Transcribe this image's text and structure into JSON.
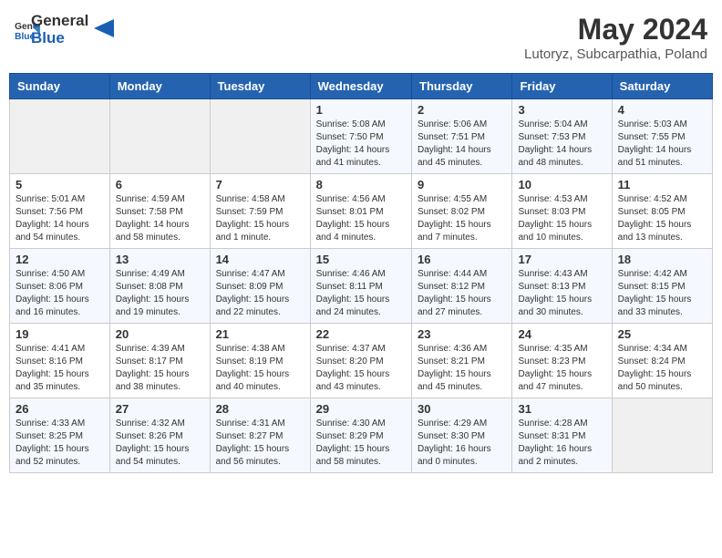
{
  "header": {
    "logo_general": "General",
    "logo_blue": "Blue",
    "month_title": "May 2024",
    "subtitle": "Lutoryz, Subcarpathia, Poland"
  },
  "weekdays": [
    "Sunday",
    "Monday",
    "Tuesday",
    "Wednesday",
    "Thursday",
    "Friday",
    "Saturday"
  ],
  "weeks": [
    [
      {
        "day": "",
        "info": ""
      },
      {
        "day": "",
        "info": ""
      },
      {
        "day": "",
        "info": ""
      },
      {
        "day": "1",
        "info": "Sunrise: 5:08 AM\nSunset: 7:50 PM\nDaylight: 14 hours\nand 41 minutes."
      },
      {
        "day": "2",
        "info": "Sunrise: 5:06 AM\nSunset: 7:51 PM\nDaylight: 14 hours\nand 45 minutes."
      },
      {
        "day": "3",
        "info": "Sunrise: 5:04 AM\nSunset: 7:53 PM\nDaylight: 14 hours\nand 48 minutes."
      },
      {
        "day": "4",
        "info": "Sunrise: 5:03 AM\nSunset: 7:55 PM\nDaylight: 14 hours\nand 51 minutes."
      }
    ],
    [
      {
        "day": "5",
        "info": "Sunrise: 5:01 AM\nSunset: 7:56 PM\nDaylight: 14 hours\nand 54 minutes."
      },
      {
        "day": "6",
        "info": "Sunrise: 4:59 AM\nSunset: 7:58 PM\nDaylight: 14 hours\nand 58 minutes."
      },
      {
        "day": "7",
        "info": "Sunrise: 4:58 AM\nSunset: 7:59 PM\nDaylight: 15 hours\nand 1 minute."
      },
      {
        "day": "8",
        "info": "Sunrise: 4:56 AM\nSunset: 8:01 PM\nDaylight: 15 hours\nand 4 minutes."
      },
      {
        "day": "9",
        "info": "Sunrise: 4:55 AM\nSunset: 8:02 PM\nDaylight: 15 hours\nand 7 minutes."
      },
      {
        "day": "10",
        "info": "Sunrise: 4:53 AM\nSunset: 8:03 PM\nDaylight: 15 hours\nand 10 minutes."
      },
      {
        "day": "11",
        "info": "Sunrise: 4:52 AM\nSunset: 8:05 PM\nDaylight: 15 hours\nand 13 minutes."
      }
    ],
    [
      {
        "day": "12",
        "info": "Sunrise: 4:50 AM\nSunset: 8:06 PM\nDaylight: 15 hours\nand 16 minutes."
      },
      {
        "day": "13",
        "info": "Sunrise: 4:49 AM\nSunset: 8:08 PM\nDaylight: 15 hours\nand 19 minutes."
      },
      {
        "day": "14",
        "info": "Sunrise: 4:47 AM\nSunset: 8:09 PM\nDaylight: 15 hours\nand 22 minutes."
      },
      {
        "day": "15",
        "info": "Sunrise: 4:46 AM\nSunset: 8:11 PM\nDaylight: 15 hours\nand 24 minutes."
      },
      {
        "day": "16",
        "info": "Sunrise: 4:44 AM\nSunset: 8:12 PM\nDaylight: 15 hours\nand 27 minutes."
      },
      {
        "day": "17",
        "info": "Sunrise: 4:43 AM\nSunset: 8:13 PM\nDaylight: 15 hours\nand 30 minutes."
      },
      {
        "day": "18",
        "info": "Sunrise: 4:42 AM\nSunset: 8:15 PM\nDaylight: 15 hours\nand 33 minutes."
      }
    ],
    [
      {
        "day": "19",
        "info": "Sunrise: 4:41 AM\nSunset: 8:16 PM\nDaylight: 15 hours\nand 35 minutes."
      },
      {
        "day": "20",
        "info": "Sunrise: 4:39 AM\nSunset: 8:17 PM\nDaylight: 15 hours\nand 38 minutes."
      },
      {
        "day": "21",
        "info": "Sunrise: 4:38 AM\nSunset: 8:19 PM\nDaylight: 15 hours\nand 40 minutes."
      },
      {
        "day": "22",
        "info": "Sunrise: 4:37 AM\nSunset: 8:20 PM\nDaylight: 15 hours\nand 43 minutes."
      },
      {
        "day": "23",
        "info": "Sunrise: 4:36 AM\nSunset: 8:21 PM\nDaylight: 15 hours\nand 45 minutes."
      },
      {
        "day": "24",
        "info": "Sunrise: 4:35 AM\nSunset: 8:23 PM\nDaylight: 15 hours\nand 47 minutes."
      },
      {
        "day": "25",
        "info": "Sunrise: 4:34 AM\nSunset: 8:24 PM\nDaylight: 15 hours\nand 50 minutes."
      }
    ],
    [
      {
        "day": "26",
        "info": "Sunrise: 4:33 AM\nSunset: 8:25 PM\nDaylight: 15 hours\nand 52 minutes."
      },
      {
        "day": "27",
        "info": "Sunrise: 4:32 AM\nSunset: 8:26 PM\nDaylight: 15 hours\nand 54 minutes."
      },
      {
        "day": "28",
        "info": "Sunrise: 4:31 AM\nSunset: 8:27 PM\nDaylight: 15 hours\nand 56 minutes."
      },
      {
        "day": "29",
        "info": "Sunrise: 4:30 AM\nSunset: 8:29 PM\nDaylight: 15 hours\nand 58 minutes."
      },
      {
        "day": "30",
        "info": "Sunrise: 4:29 AM\nSunset: 8:30 PM\nDaylight: 16 hours\nand 0 minutes."
      },
      {
        "day": "31",
        "info": "Sunrise: 4:28 AM\nSunset: 8:31 PM\nDaylight: 16 hours\nand 2 minutes."
      },
      {
        "day": "",
        "info": ""
      }
    ]
  ]
}
